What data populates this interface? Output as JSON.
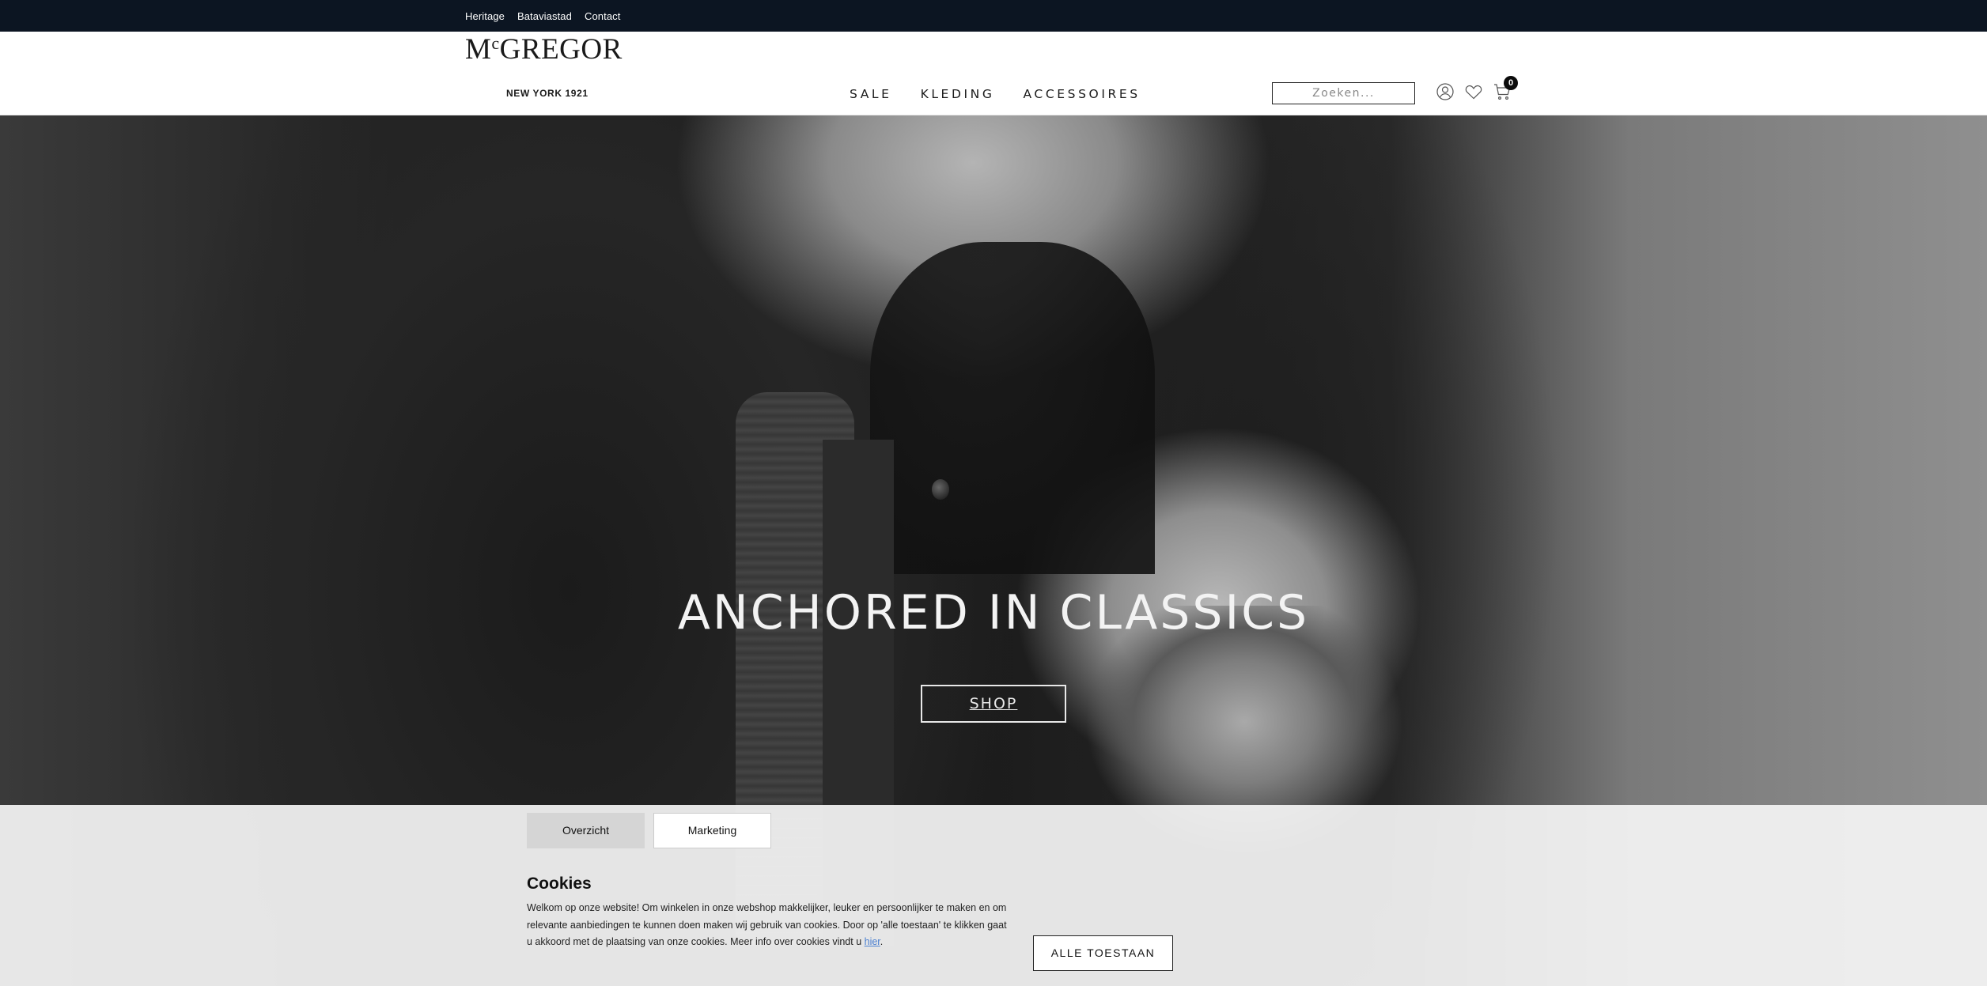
{
  "topbar": {
    "links": [
      "Heritage",
      "Bataviastad",
      "Contact"
    ]
  },
  "header": {
    "logo": {
      "wordmark_pre": "M",
      "wordmark_c": "c",
      "wordmark_post": "GREGOR",
      "sub": "NEW YORK 1921"
    },
    "nav": [
      "SALE",
      "KLEDING",
      "ACCESSOIRES"
    ],
    "search": {
      "placeholder": "Zoeken..."
    },
    "icons": [
      "account-icon",
      "heart-icon",
      "cart-icon"
    ],
    "cart_count": "0"
  },
  "hero": {
    "title": "ANCHORED IN CLASSICS",
    "cta": "SHOP"
  },
  "cookie": {
    "tabs": [
      "Overzicht",
      "Marketing"
    ],
    "active_tab": "Overzicht",
    "title": "Cookies",
    "text": "Welkom op onze website! Om winkelen in onze webshop makkelijker, leuker en persoonlijker te maken en om relevante aanbiedingen te kunnen doen maken wij gebruik van cookies. Door op 'alle toestaan' te klikken gaat u akkoord met de plaatsing van onze cookies. Meer info over cookies vindt u ",
    "link_text": "hier",
    "text_end": ".",
    "accept_label": "ALLE TOESTAAN"
  },
  "colors": {
    "topbar_bg": "#0c1522",
    "link_blue": "#4a7fd0",
    "active_tab_bg": "#d5d5d5"
  }
}
